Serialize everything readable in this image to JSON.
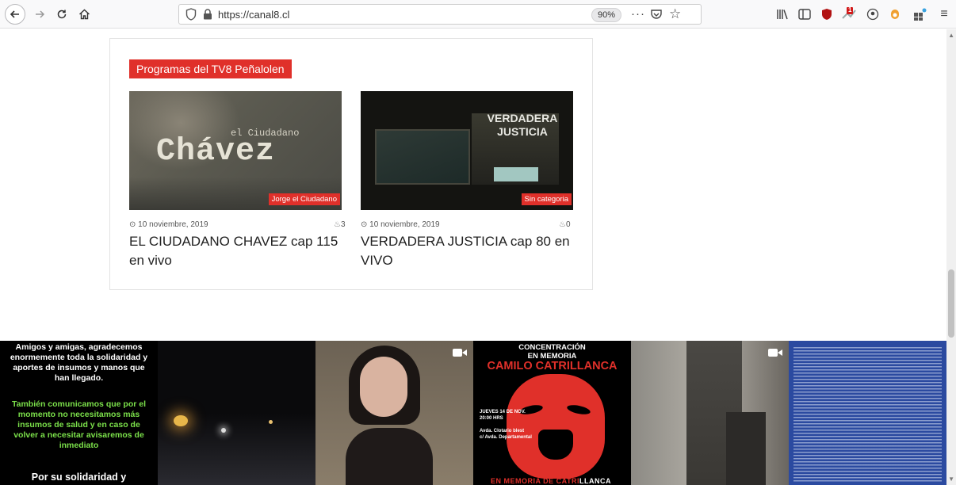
{
  "browser": {
    "url": "https://canal8.cl",
    "zoom": "90%",
    "notification_count": "1"
  },
  "section": {
    "title": "Programas del TV8 Peñalolen"
  },
  "posts": [
    {
      "thumb_text_line1": "el Ciudadano",
      "thumb_text_line2": "Chávez",
      "category": "Jorge el Ciudadano",
      "date": "10 noviembre, 2019",
      "count": "3",
      "title": "EL CIUDADANO CHAVEZ cap 115 en vivo"
    },
    {
      "thumb_text_line1": "VERDADERA",
      "thumb_text_line2": "JUSTICIA",
      "category": "Sin categoria",
      "date": "10 noviembre, 2019",
      "count": "0",
      "title": "VERDADERA JUSTICIA cap 80 en VIVO"
    }
  ],
  "instagram": {
    "tile1_text_a": "Amigos y amigas, agradecemos enormemente toda la solidaridad y aportes de insumos y manos que han llegado.",
    "tile1_text_b": "También comunicamos que por el momento no necesitamos más insumos de salud y en caso de volver a necesitar avisaremos de inmediato",
    "tile1_text_c": "Por su solidaridad y",
    "tile4_head1": "CONCENTRACIÓN",
    "tile4_head2": "EN MEMORIA",
    "tile4_name": "CAMILO CATRILLANCA",
    "tile4_date": "JUEVES 14 DE NOV.",
    "tile4_time": "20:00 HRS",
    "tile4_place1": "Avda. Clotario blest",
    "tile4_place2": "c/ Avda. Departamental",
    "tile4_footer_a": "EN MEMORIA DE CATRI",
    "tile4_footer_b": "LLANCA"
  },
  "colors": {
    "accent": "#e0302a",
    "tile1_green": "#7be04a"
  }
}
